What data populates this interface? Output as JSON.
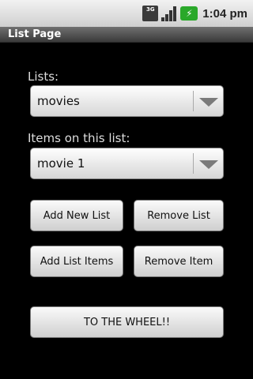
{
  "status_bar": {
    "network_label": "3G",
    "time": "1:04 pm"
  },
  "title_bar": {
    "title": "List Page"
  },
  "lists": {
    "label": "Lists:",
    "selected": "movies"
  },
  "items": {
    "label": "Items on this list:",
    "selected": "movie 1"
  },
  "buttons": {
    "add_new_list": "Add New List",
    "remove_list": "Remove List",
    "add_list_items": "Add List Items",
    "remove_item": "Remove Item",
    "to_the_wheel": "TO THE WHEEL!!"
  },
  "icons": {
    "network": "3g-icon",
    "signal": "signal-strength-icon",
    "battery": "battery-charging-icon",
    "dropdown": "chevron-down-icon"
  },
  "colors": {
    "background": "#000000",
    "battery": "#2aa82a"
  }
}
